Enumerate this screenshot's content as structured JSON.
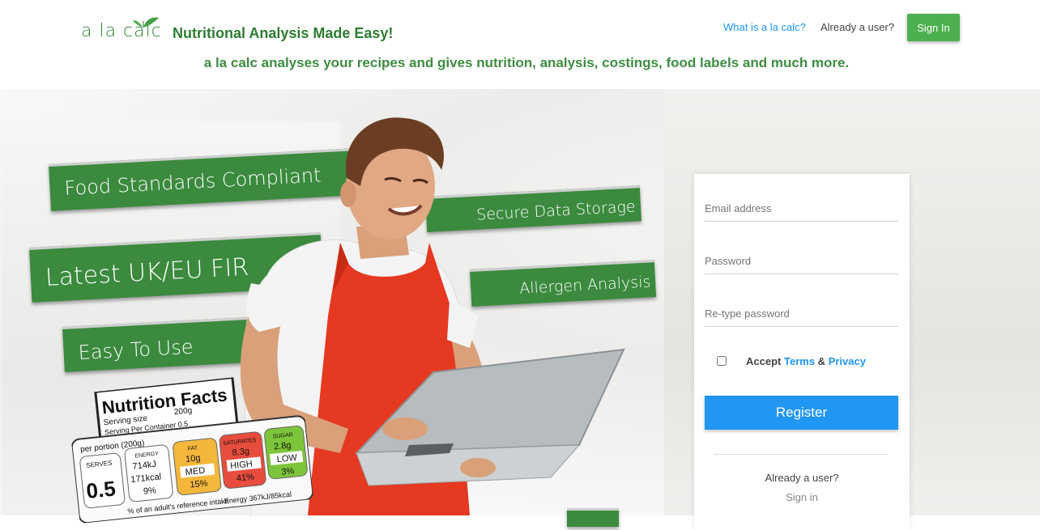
{
  "header": {
    "logo_text": "a la calc",
    "tagline": "Nutritional Analysis Made Easy!",
    "nav_what": "What is a la calc?",
    "nav_already": "Already a user?",
    "signin_label": "Sign In"
  },
  "subtitle": "a la calc analyses your recipes and gives nutrition, analysis, costings, food labels and much more.",
  "hero": {
    "banners": [
      "Food Standards Compliant",
      "Secure Data Storage",
      "Latest UK/EU FIR",
      "Allergen Analysis",
      "Easy To Use"
    ],
    "nutrition_label": {
      "title": "Nutrition Facts",
      "serving_size_label": "Serving size",
      "serving_size_value": "200g",
      "servings_per_container": "Serving Per Container 0.5",
      "per_portion": "per portion (200g)",
      "serves_label": "SERVES",
      "serves_value": "0.5",
      "energy_label": "ENERGY",
      "energy_kj": "714kJ",
      "energy_kcal": "171kcal",
      "energy_pct": "9%",
      "fat_label": "FAT",
      "fat_value": "10g",
      "fat_level": "MED",
      "fat_pct": "15%",
      "sat_label": "SATURATES",
      "sat_value": "8.3g",
      "sat_level": "HIGH",
      "sat_pct": "41%",
      "sugar_label": "SUGAR",
      "sugar_value": "2.8g",
      "sugar_level": "LOW",
      "sugar_pct": "3%",
      "footer": "% of an adult's reference intake",
      "footer2": "Energy 367kJ/85kcal"
    }
  },
  "form": {
    "email_placeholder": "Email address",
    "password_placeholder": "Password",
    "retype_placeholder": "Re-type password",
    "accept_label": "Accept",
    "terms_link": "Terms",
    "amp": "&",
    "privacy_link": "Privacy",
    "register_label": "Register",
    "already_user": "Already a user?",
    "sign_in_link": "Sign in"
  },
  "colors": {
    "brand_green": "#2e7d32",
    "banner_green": "#3b8a3e",
    "accent_blue": "#2196f3",
    "signin_green": "#4caf50"
  }
}
